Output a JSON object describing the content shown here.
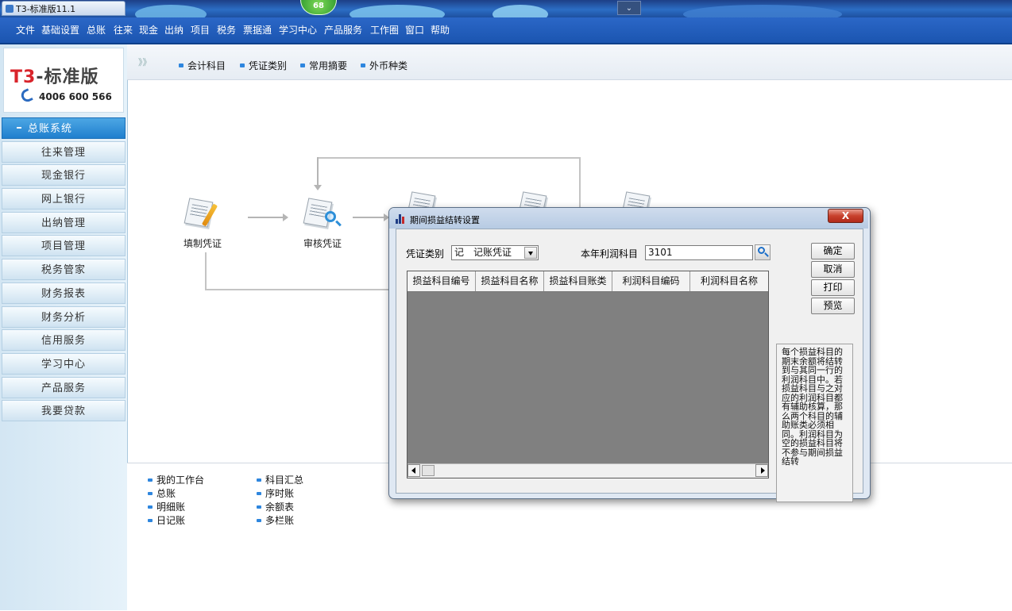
{
  "window": {
    "title": "T3-标准版11.1",
    "badge": "68"
  },
  "menu": [
    "文件",
    "基础设置",
    "总账",
    "往来",
    "现金",
    "出纳",
    "项目",
    "税务",
    "票据通",
    "学习中心",
    "产品服务",
    "工作圈",
    "窗口",
    "帮助"
  ],
  "logo": {
    "brand_prefix": "T3",
    "brand_suffix": "-标准版",
    "phone": "4006 600 566"
  },
  "sidebar": {
    "items": [
      {
        "label": "总账系统"
      },
      {
        "label": "往来管理"
      },
      {
        "label": "现金银行"
      },
      {
        "label": "网上银行"
      },
      {
        "label": "出纳管理"
      },
      {
        "label": "项目管理"
      },
      {
        "label": "税务管家"
      },
      {
        "label": "财务报表"
      },
      {
        "label": "财务分析"
      },
      {
        "label": "信用服务"
      },
      {
        "label": "学习中心"
      },
      {
        "label": "产品服务"
      },
      {
        "label": "我要贷款"
      }
    ]
  },
  "toolbar": {
    "arrows": "》》",
    "links": [
      "会计科目",
      "凭证类别",
      "常用摘要",
      "外币种类"
    ]
  },
  "workflow": {
    "step1": "填制凭证",
    "step2": "审核凭证"
  },
  "quick_links": {
    "col1": [
      "我的工作台",
      "总账",
      "明细账",
      "日记账"
    ],
    "col2": [
      "科目汇总",
      "序时账",
      "余额表",
      "多栏账"
    ]
  },
  "dialog": {
    "title": "期间损益结转设置",
    "close": "X",
    "voucher_type_label": "凭证类别",
    "voucher_type_value": "记　记账凭证",
    "profit_account_label": "本年利润科目",
    "profit_account_value": "3101",
    "columns": [
      "损益科目编号",
      "损益科目名称",
      "损益科目账类",
      "利润科目编码",
      "利润科目名称"
    ],
    "buttons": {
      "ok": "确定",
      "cancel": "取消",
      "print": "打印",
      "preview": "预览"
    },
    "notes": "每个损益科目的期末余额将结转到与其同一行的利润科目中。若损益科目与之对应的利润科目都有辅助核算，那么两个科目的辅助账类必须相同。利润科目为空的损益科目将不参与期间损益结转"
  }
}
